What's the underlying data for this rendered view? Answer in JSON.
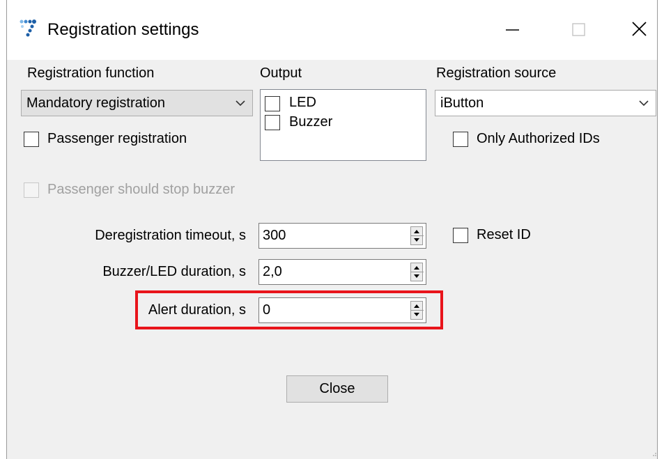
{
  "window": {
    "title": "Registration settings",
    "icon": "app-dots-icon"
  },
  "registration_function": {
    "label": "Registration function",
    "selected": "Mandatory registration"
  },
  "output": {
    "label": "Output",
    "items": [
      {
        "label": "LED",
        "checked": false
      },
      {
        "label": "Buzzer",
        "checked": false
      }
    ]
  },
  "registration_source": {
    "label": "Registration source",
    "selected": "iButton"
  },
  "checkboxes": {
    "passenger_registration": {
      "label": "Passenger registration",
      "checked": false
    },
    "only_authorized": {
      "label": "Only Authorized IDs",
      "checked": false
    },
    "passenger_stop_buzzer": {
      "label": "Passenger should stop buzzer",
      "checked": false,
      "enabled": false
    },
    "reset_id": {
      "label": "Reset ID",
      "checked": false
    }
  },
  "fields": {
    "deregistration_timeout": {
      "label": "Deregistration timeout, s",
      "value": "300"
    },
    "buzzer_led_duration": {
      "label": "Buzzer/LED duration, s",
      "value": "2,0"
    },
    "alert_duration": {
      "label": "Alert duration, s",
      "value": "0"
    }
  },
  "close_button": {
    "label": "Close"
  },
  "colors": {
    "highlight": "#e8141b",
    "dialog_bg": "#f0f0f0",
    "icon_blue": "#1d5fa7"
  }
}
